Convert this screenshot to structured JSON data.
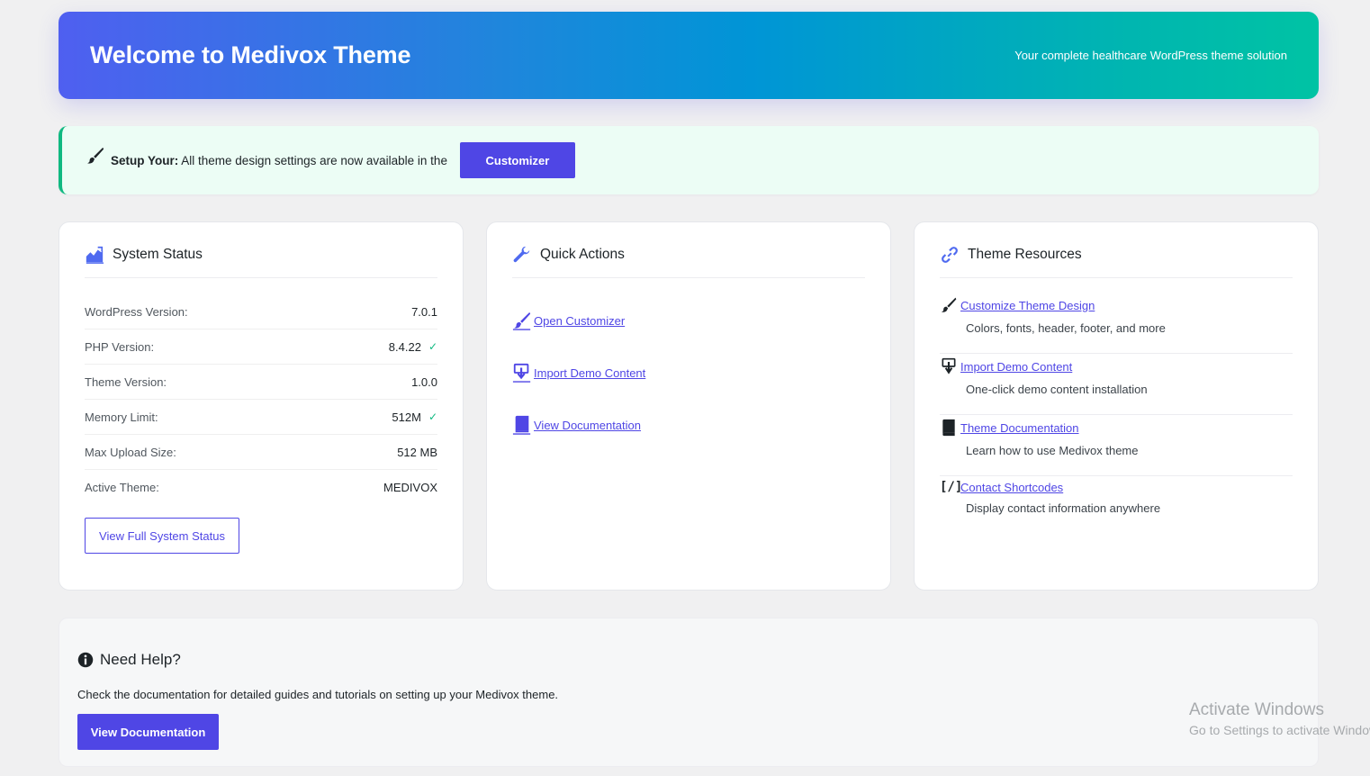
{
  "header": {
    "title": "Welcome to Medivox Theme",
    "tagline": "Your complete healthcare WordPress theme solution"
  },
  "notice": {
    "label": "Setup Your:",
    "text": " All theme design settings are now available in the",
    "button": "Customizer"
  },
  "system_status": {
    "title": "System Status",
    "rows": [
      {
        "label": "WordPress Version:",
        "value": "7.0.1",
        "ok": false
      },
      {
        "label": "PHP Version:",
        "value": "8.4.22",
        "ok": true
      },
      {
        "label": "Theme Version:",
        "value": "1.0.0",
        "ok": false
      },
      {
        "label": "Memory Limit:",
        "value": "512M",
        "ok": true
      },
      {
        "label": "Max Upload Size:",
        "value": "512 MB",
        "ok": false
      },
      {
        "label": "Active Theme:",
        "value": "MEDIVOX",
        "ok": false
      }
    ],
    "button": "View Full System Status"
  },
  "quick_actions": {
    "title": "Quick Actions",
    "items": [
      {
        "label": " Open Customizer",
        "icon": "paintbrush-icon"
      },
      {
        "label": " Import Demo Content",
        "icon": "import-icon"
      },
      {
        "label": " View Documentation",
        "icon": "book-icon"
      }
    ]
  },
  "resources": {
    "title": "Theme Resources",
    "items": [
      {
        "label": "Customize Theme Design",
        "desc": "Colors, fonts, header, footer, and more",
        "icon": "paintbrush-icon"
      },
      {
        "label": "Import Demo Content",
        "desc": "One-click demo content installation",
        "icon": "import-icon"
      },
      {
        "label": "Theme Documentation",
        "desc": "Learn how to use Medivox theme",
        "icon": "book-icon"
      },
      {
        "label": "Contact Shortcodes",
        "desc": "Display contact information anywhere",
        "icon": "shortcode-icon",
        "glyph": "[/]"
      }
    ]
  },
  "help": {
    "title": "Need Help?",
    "text": "Check the documentation for detailed guides and tutorials on setting up your Medivox theme.",
    "button": "View Documentation"
  },
  "watermark": {
    "line1": "Activate Windows",
    "line2": "Go to Settings to activate Windows."
  },
  "colors": {
    "accent": "#4f46e5",
    "success": "#10b981",
    "gradient_start": "#4f5ff0",
    "gradient_end": "#00c3a4"
  }
}
